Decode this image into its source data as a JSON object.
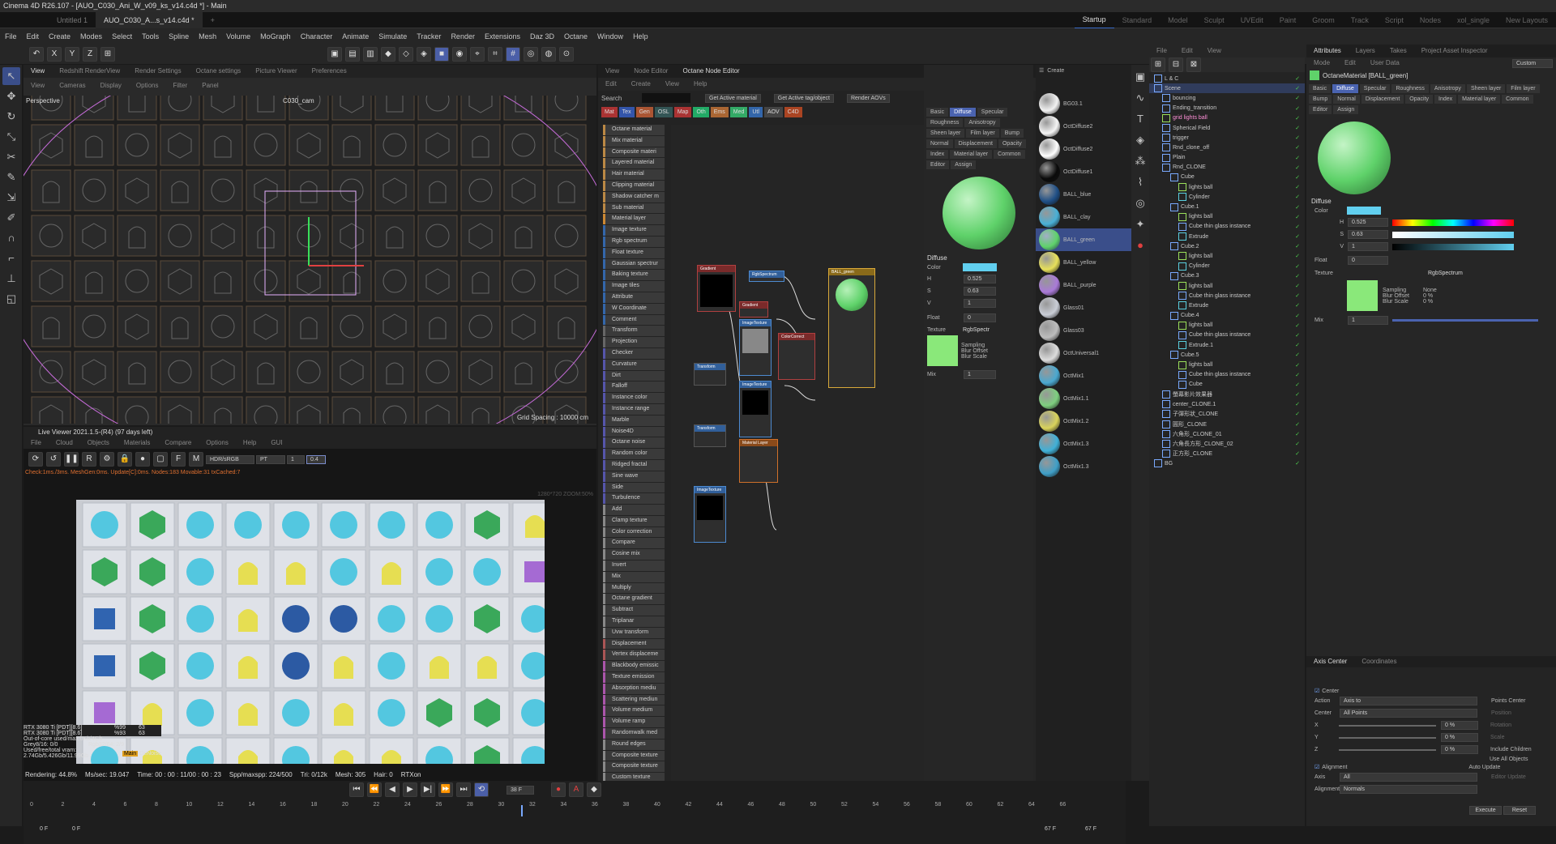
{
  "window": {
    "title": "Cinema 4D R26.107 - [AUO_C030_Ani_W_v09_ks_v14.c4d *] - Main"
  },
  "doc_tabs": [
    {
      "label": "Untitled 1"
    },
    {
      "label": "AUO_C030_A...s_v14.c4d *"
    },
    {
      "label": "+"
    }
  ],
  "layout_tabs": [
    {
      "label": "Startup"
    },
    {
      "label": "Standard"
    },
    {
      "label": "Model"
    },
    {
      "label": "Sculpt"
    },
    {
      "label": "UVEdit"
    },
    {
      "label": "Paint"
    },
    {
      "label": "Groom"
    },
    {
      "label": "Track"
    },
    {
      "label": "Script"
    },
    {
      "label": "Nodes"
    },
    {
      "label": "xol_single"
    },
    {
      "label": "New Layouts"
    }
  ],
  "menus": [
    "File",
    "Edit",
    "Create",
    "Modes",
    "Select",
    "Tools",
    "Spline",
    "Mesh",
    "Volume",
    "MoGraph",
    "Character",
    "Animate",
    "Simulate",
    "Tracker",
    "Render",
    "Extensions",
    "Daz 3D",
    "Octane",
    "Window",
    "Help"
  ],
  "viewport": {
    "tabs": [
      "View",
      "Redshift RenderView",
      "Render Settings",
      "Octane settings",
      "Picture Viewer",
      "Preferences"
    ],
    "menu": [
      "View",
      "Cameras",
      "Display",
      "Options",
      "Filter",
      "Panel"
    ],
    "label": "Perspective",
    "camera": "C030_cam",
    "grid_spacing": "Grid Spacing : 10000 cm"
  },
  "live_viewer": {
    "title": "Live Viewer 2021.1.5-(R4) (97 days left)",
    "menu": [
      "File",
      "Cloud",
      "Objects",
      "Materials",
      "Compare",
      "Options",
      "Help",
      "GUI"
    ],
    "colorspace": "HDR/sRGB",
    "mode": "PT",
    "value1": "1",
    "value2": "0.4",
    "status": "Check:1ms./3ms. MeshGen:0ms. Update[C]:0ms. Nodes:183 Movable:31 txCached:7",
    "gpu1": "RTX 3080 Ti [PDT][8.6]",
    "gpu1_pct": "%99",
    "gpu1_val": "63",
    "gpu2": "RTX 3080 Ti [PDT][8.6]",
    "gpu2_pct": "%93",
    "gpu2_val": "63",
    "out_of_core": "Out-of-core used/max:0Kb/4Gb",
    "grey": "Grey8/16: 0/0",
    "rgb": "Rgb32/64: 2/9",
    "vram": "Used/free/total vram: 2.74Gb/5.426Gb/11.99Gb",
    "tag": "Main",
    "noise": "DeNoise",
    "rendering": "Rendering: 44.8%",
    "ms": "Ms/sec: 19.047",
    "time": "Time: 00 : 00 : 11/00 : 00 : 23",
    "spp": "Spp/maxspp: 224/500",
    "tri": "Tri: 0/12k",
    "mesh": "Mesh: 305",
    "hair": "Hair: 0",
    "rtx": "RTXon",
    "watermark": "1280*720 ZOOM:50%"
  },
  "node_editor": {
    "tabs": [
      "View",
      "Node Editor",
      "Octane Node Editor"
    ],
    "menu": [
      "Edit",
      "Create",
      "View",
      "Help"
    ],
    "search_label": "Search",
    "buttons": [
      "Get Active material",
      "Get Active tag/object",
      "Render AOVs"
    ],
    "cat_tabs": [
      "Mat",
      "Tex",
      "Gen",
      "OSL",
      "Map",
      "Oth",
      "Ems",
      "Med",
      "Utl",
      "AOV",
      "C4D"
    ],
    "list": [
      "Octane material",
      "Mix material",
      "Composite materi",
      "Layered material",
      "Hair material",
      "Clipping material",
      "Shadow catcher m",
      "Sub material",
      "Material layer",
      "Image texture",
      "Rgb spectrum",
      "Float texture",
      "Gaussian spectrur",
      "Baking texture",
      "Image tiles",
      "Attribute",
      "W Coordinate",
      "Comment",
      "Transform",
      "Projection",
      "Checker",
      "Curvature",
      "Dirt",
      "Falloff",
      "Instance color",
      "Instance range",
      "Marble",
      "Noise4D",
      "Octane noise",
      "Random color",
      "Ridged fractal",
      "Sine wave",
      "Side",
      "Turbulence",
      "Add",
      "Clamp texture",
      "Color correction",
      "Compare",
      "Cosine mix",
      "Invert",
      "Mix",
      "Multiply",
      "Octane gradient",
      "Subtract",
      "Triplanar",
      "Uvw transform",
      "Displacement",
      "Vertex displaceme",
      "Blackbody emissic",
      "Texture emission",
      "Absorption mediu",
      "Scattering mediun",
      "Volume medium",
      "Volume ramp",
      "Randomwalk med",
      "Round edges",
      "Composite texture",
      "Composite texture",
      "Custom texture",
      "Custom pattern"
    ],
    "nodes": {
      "gradient": "Gradient",
      "rgbspectrum": "RgbSpectrum",
      "ball_green": "BALL_green",
      "gradient2": "Gradient",
      "imagetexture1": "ImageTexture",
      "colorcorrect": "ColorCorrect",
      "transform1": "Transform",
      "imagetexture2": "ImageTexture",
      "transform2": "Transform",
      "material_layer": "Material Layer",
      "imagetexture3": "ImageTexture"
    }
  },
  "mat_panel": {
    "tabs": [
      "Basic",
      "Diffuse",
      "Specular",
      "Roughness",
      "Anisotropy",
      "Sheen layer",
      "Film layer",
      "Bump",
      "Normal",
      "Displacement",
      "Opacity",
      "Index",
      "Material layer",
      "Common",
      "Editor",
      "Assign"
    ],
    "section": "Diffuse",
    "color_label": "Color",
    "h_label": "H",
    "h": "0.525",
    "s_label": "S",
    "s": "0.63",
    "v_label": "V",
    "v": "1",
    "float_label": "Float",
    "float": "0",
    "texture_label": "Texture",
    "texture": "RgbSpectr",
    "sampling": "Sampling",
    "blur_offset": "Blur Offset",
    "blur_scale": "Blur Scale",
    "mix_label": "Mix",
    "mix": "1"
  },
  "materials": [
    {
      "name": "BG03.1",
      "color": "#f2f2f2"
    },
    {
      "name": "OctDiffuse2",
      "color": "#f5f5f5"
    },
    {
      "name": "OctDiffuse2",
      "color": "#ffffff"
    },
    {
      "name": "OctDiffuse1",
      "color": "#0a0a0a"
    },
    {
      "name": "BALL_blue",
      "color": "#1f4f86"
    },
    {
      "name": "BALL_clay",
      "color": "#49b0d6"
    },
    {
      "name": "BALL_green",
      "color": "#5fd26a"
    },
    {
      "name": "BALL_yellow",
      "color": "#e7e05a"
    },
    {
      "name": "BALL_purple",
      "color": "#a97ad8"
    },
    {
      "name": "Glass01",
      "color": "#c9cdd6"
    },
    {
      "name": "Glass03",
      "color": "#bdbdbd"
    },
    {
      "name": "OctUniversal1",
      "color": "#dcdcdc"
    },
    {
      "name": "OctMix1",
      "color": "#4aa8d0"
    },
    {
      "name": "OctMix1.1",
      "color": "#7ecf7f"
    },
    {
      "name": "OctMix1.2",
      "color": "#d9d35b"
    },
    {
      "name": "OctMix1.3",
      "color": "#40b0d7"
    },
    {
      "name": "OctMix1.3",
      "color": "#3f9fc7"
    }
  ],
  "objmgr": {
    "menu": [
      "File",
      "Edit",
      "View"
    ],
    "items": [
      {
        "d": 0,
        "n": "L & C"
      },
      {
        "d": 0,
        "n": "Scene"
      },
      {
        "d": 1,
        "n": "bouncing"
      },
      {
        "d": 1,
        "n": "Ending_transition"
      },
      {
        "d": 1,
        "n": "grid lights ball"
      },
      {
        "d": 1,
        "n": "Spherical Field"
      },
      {
        "d": 1,
        "n": "trigger"
      },
      {
        "d": 1,
        "n": "Rnd_clone_off"
      },
      {
        "d": 1,
        "n": "Plain"
      },
      {
        "d": 1,
        "n": "Rnd_CLONE"
      },
      {
        "d": 2,
        "n": "Cube"
      },
      {
        "d": 3,
        "n": "lights ball"
      },
      {
        "d": 3,
        "n": "Cylinder"
      },
      {
        "d": 2,
        "n": "Cube.1"
      },
      {
        "d": 3,
        "n": "lights ball"
      },
      {
        "d": 3,
        "n": "Cube thin glass instance"
      },
      {
        "d": 3,
        "n": "Extrude"
      },
      {
        "d": 2,
        "n": "Cube.2"
      },
      {
        "d": 3,
        "n": "lights ball"
      },
      {
        "d": 3,
        "n": "Cylinder"
      },
      {
        "d": 2,
        "n": "Cube.3"
      },
      {
        "d": 3,
        "n": "lights ball"
      },
      {
        "d": 3,
        "n": "Cube thin glass instance"
      },
      {
        "d": 3,
        "n": "Extrude"
      },
      {
        "d": 2,
        "n": "Cube.4"
      },
      {
        "d": 3,
        "n": "lights ball"
      },
      {
        "d": 3,
        "n": "Cube thin glass instance"
      },
      {
        "d": 3,
        "n": "Extrude.1"
      },
      {
        "d": 2,
        "n": "Cube.5"
      },
      {
        "d": 3,
        "n": "lights ball"
      },
      {
        "d": 3,
        "n": "Cube thin glass instance"
      },
      {
        "d": 3,
        "n": "Cube"
      },
      {
        "d": 1,
        "n": "螢幕影片效果器"
      },
      {
        "d": 1,
        "n": "center_CLONE.1"
      },
      {
        "d": 1,
        "n": "子彈形狀_CLONE"
      },
      {
        "d": 1,
        "n": "圓形_CLONE"
      },
      {
        "d": 1,
        "n": "六角形_CLONE_01"
      },
      {
        "d": 1,
        "n": "六角長方形_CLONE_02"
      },
      {
        "d": 1,
        "n": "正方形_CLONE"
      },
      {
        "d": 0,
        "n": "BG"
      }
    ]
  },
  "attributes": {
    "tabs": [
      "Attributes",
      "Layers",
      "Takes",
      "Project Asset Inspector"
    ],
    "menu": [
      "Mode",
      "Edit",
      "User Data"
    ],
    "custom": "Custom",
    "mat_name": "OctaneMaterial [BALL_green]",
    "subtabs": [
      "Basic",
      "Diffuse",
      "Specular",
      "Roughness",
      "Anisotropy",
      "Sheen layer",
      "Film layer",
      "Bump",
      "Normal",
      "Displacement",
      "Opacity",
      "Index",
      "Material layer",
      "Common",
      "Editor",
      "Assign"
    ],
    "section": "Diffuse",
    "color_label": "Color",
    "h_label": "H",
    "h": "0.525",
    "s_label": "S",
    "s": "0.63",
    "v_label": "V",
    "v": "1",
    "float_label": "Float",
    "float": "0",
    "texture_label": "Texture",
    "texture": "RgbSpectrum",
    "sampling": "Sampling",
    "sampling_val": "None",
    "blur_offset": "Blur Offset",
    "blur_offset_val": "0 %",
    "blur_scale": "Blur Scale",
    "blur_scale_val": "0 %",
    "mix_label": "Mix",
    "mix": "1"
  },
  "axis_center": {
    "tabs": [
      "Axis Center",
      "Coordinates"
    ],
    "center_chk": "Center",
    "action_label": "Action",
    "action": "Axis to",
    "center_label": "Center",
    "center": "All Points",
    "x": "X",
    "xv": "0 %",
    "y": "Y",
    "yv": "0 %",
    "z": "Z",
    "zv": "0 %",
    "points_center": "Points Center",
    "position": "Position",
    "rotation": "Rotation",
    "scale": "Scale",
    "include_children": "Include Children",
    "use_all": "Use All Objects",
    "alignment_chk": "Alignment",
    "axis_label": "Axis",
    "axis": "All",
    "alignment_label": "Alignment",
    "alignment": "Normals",
    "auto_update": "Auto Update",
    "editor_update": "Editor Update",
    "execute": "Execute",
    "reset": "Reset"
  },
  "timeline": {
    "frame": "38 F",
    "ticks": [
      "0",
      "2",
      "4",
      "6",
      "8",
      "10",
      "12",
      "14",
      "16",
      "18",
      "20",
      "22",
      "24",
      "26",
      "28",
      "30",
      "32",
      "34",
      "36",
      "38",
      "40",
      "42",
      "44",
      "46",
      "48",
      "50",
      "52",
      "54",
      "56",
      "58",
      "60",
      "62",
      "64",
      "66"
    ],
    "start": "0 F",
    "start2": "0 F",
    "end": "67 F",
    "end2": "67 F"
  }
}
